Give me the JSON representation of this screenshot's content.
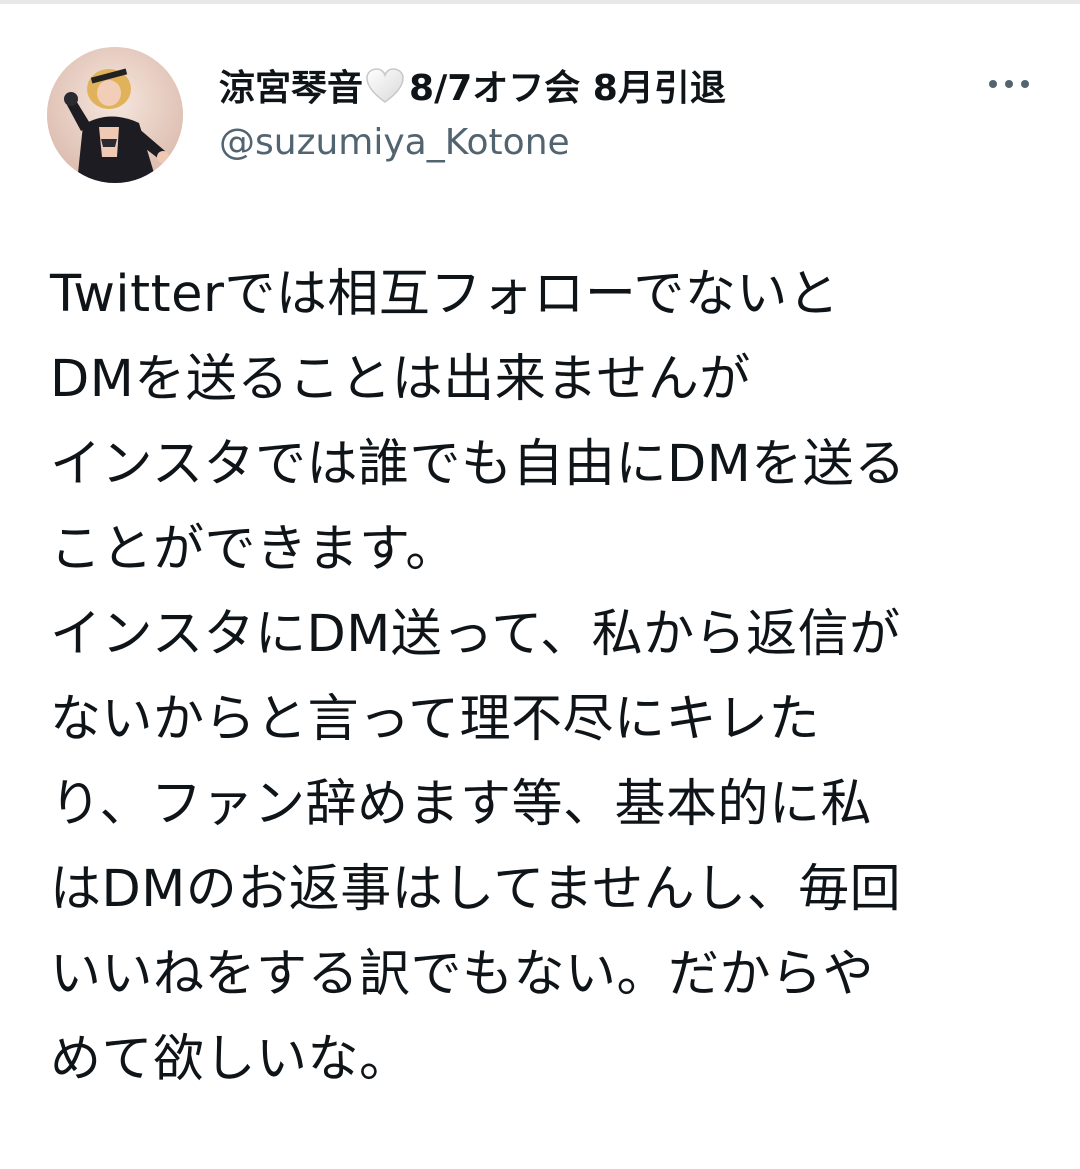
{
  "tweet": {
    "author": {
      "display_name": "涼宮琴音",
      "name_suffix": "8/7オフ会 8月引退",
      "handle": "@suzumiya_Kotone",
      "avatar_icon": "profile-photo",
      "heart_icon": "white-heart-icon"
    },
    "more_icon": "more-horizontal-icon",
    "text_lines": [
      "Twitterでは相互フォローでないと",
      "DMを送ることは出来ませんが",
      "インスタでは誰でも自由にDMを送る",
      "ことができます。",
      "インスタにDM送って、私から返信が",
      "ないからと言って理不尽にキレた",
      "り、ファン辞めます等、基本的に私",
      "はDMのお返事はしてませんし、毎回",
      "いいねをする訳でもない。だからや",
      "めて欲しいな。"
    ]
  },
  "colors": {
    "text": "#0f1419",
    "secondary": "#536471",
    "background": "#ffffff"
  }
}
